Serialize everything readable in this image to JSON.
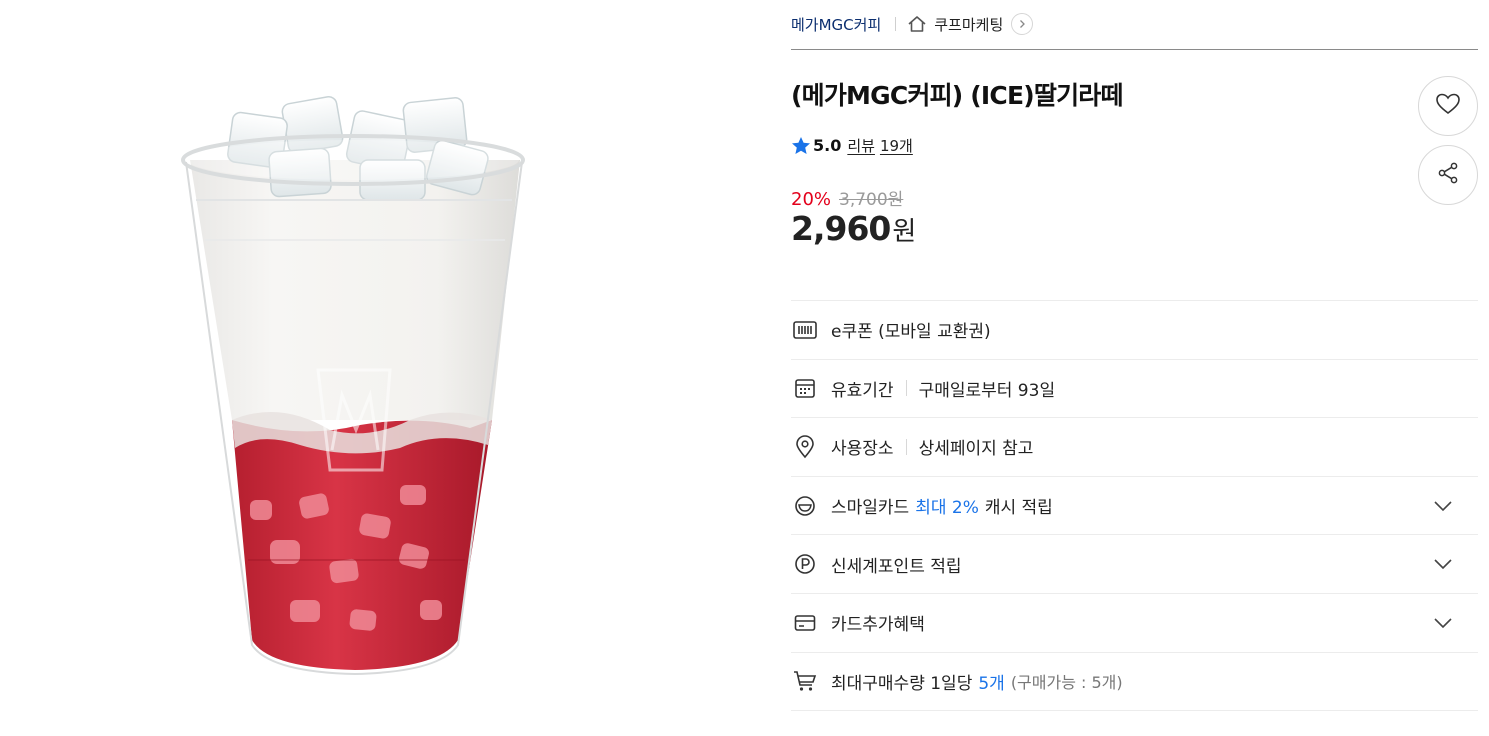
{
  "breadcrumb": {
    "brand": "메가MGC커피",
    "category": "쿠프마케팅"
  },
  "product": {
    "title": "(메가MGC커피) (ICE)딸기라떼",
    "rating": "5.0",
    "review_label": "리뷰",
    "review_count": "19개",
    "discount_rate": "20%",
    "original_price": "3,700원",
    "sale_price": "2,960",
    "sale_currency": "원"
  },
  "info": {
    "coupon_type": "e쿠폰 (모바일 교환권)",
    "validity_label": "유효기간",
    "validity_value": "구매일로부터 93일",
    "location_label": "사용장소",
    "location_value": "상세페이지 참고",
    "smilecard_prefix": "스마일카드",
    "smilecard_highlight": "최대 2%",
    "smilecard_suffix": "캐시 적립",
    "shinsegae_point": "신세계포인트 적립",
    "card_benefit": "카드추가혜택",
    "max_qty_prefix": "최대구매수량 1일당",
    "max_qty_value": "5개",
    "max_qty_note": "(구매가능 : 5개)"
  },
  "colors": {
    "brand_navy": "#0b2e6f",
    "discount_red": "#e3001b",
    "accent_blue": "#1a73e8",
    "star_blue": "#1a73e8",
    "strawberry_red": "#c8283a"
  },
  "icons": [
    "home-icon",
    "chevron-right-icon",
    "heart-icon",
    "share-icon",
    "star-icon",
    "barcode-icon",
    "calendar-icon",
    "location-pin-icon",
    "smile-icon",
    "point-icon",
    "card-icon",
    "cart-icon",
    "chevron-down-icon"
  ]
}
